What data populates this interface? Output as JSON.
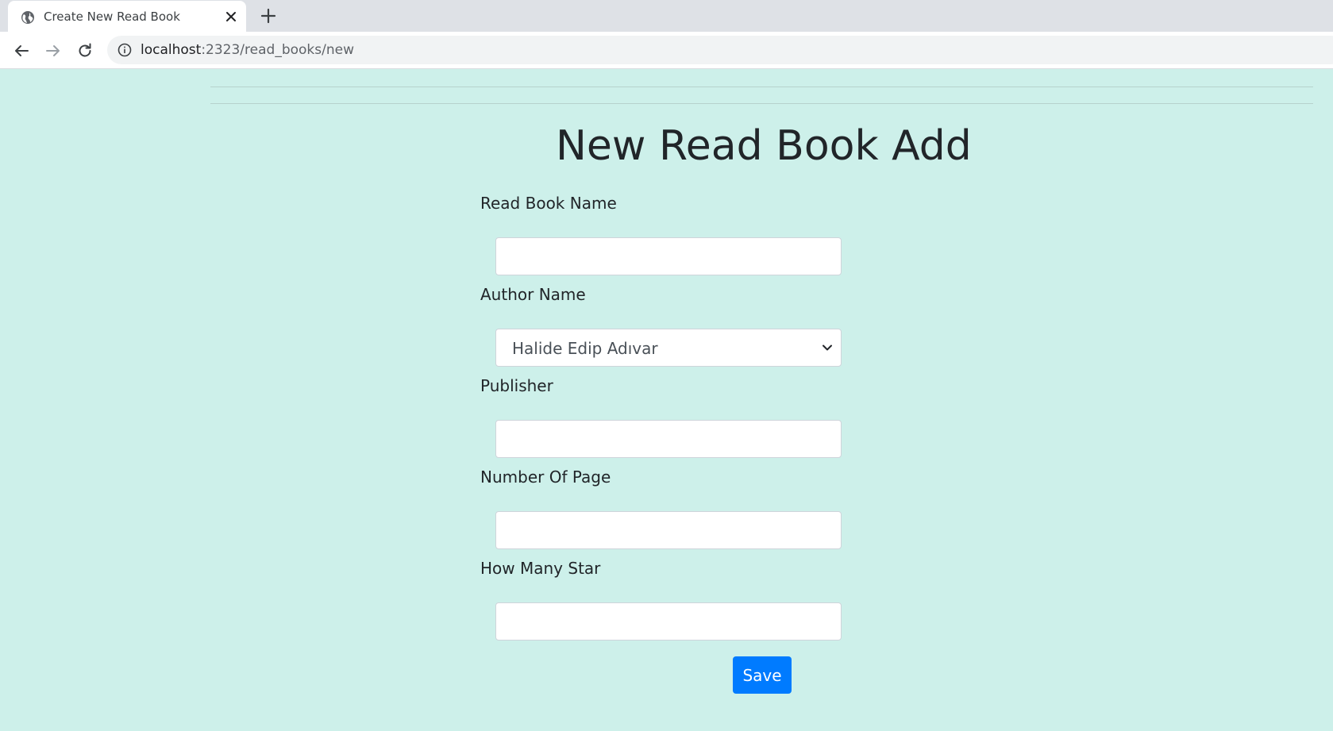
{
  "browser": {
    "tab_title": "Create New Read Book",
    "url_host": "localhost",
    "url_rest": ":2323/read_books/new"
  },
  "page": {
    "heading": "New Read Book Add",
    "fields": {
      "book_name": {
        "label": "Read Book Name",
        "value": ""
      },
      "author_name": {
        "label": "Author Name",
        "selected": "Halide Edip Adıvar"
      },
      "publisher": {
        "label": "Publisher",
        "value": ""
      },
      "page_count": {
        "label": "Number Of Page",
        "value": ""
      },
      "stars": {
        "label": "How Many Star",
        "value": ""
      }
    },
    "save_label": "Save"
  },
  "colors": {
    "page_background": "#cdf0ea",
    "primary_button": "#007bff",
    "text": "#212529"
  }
}
